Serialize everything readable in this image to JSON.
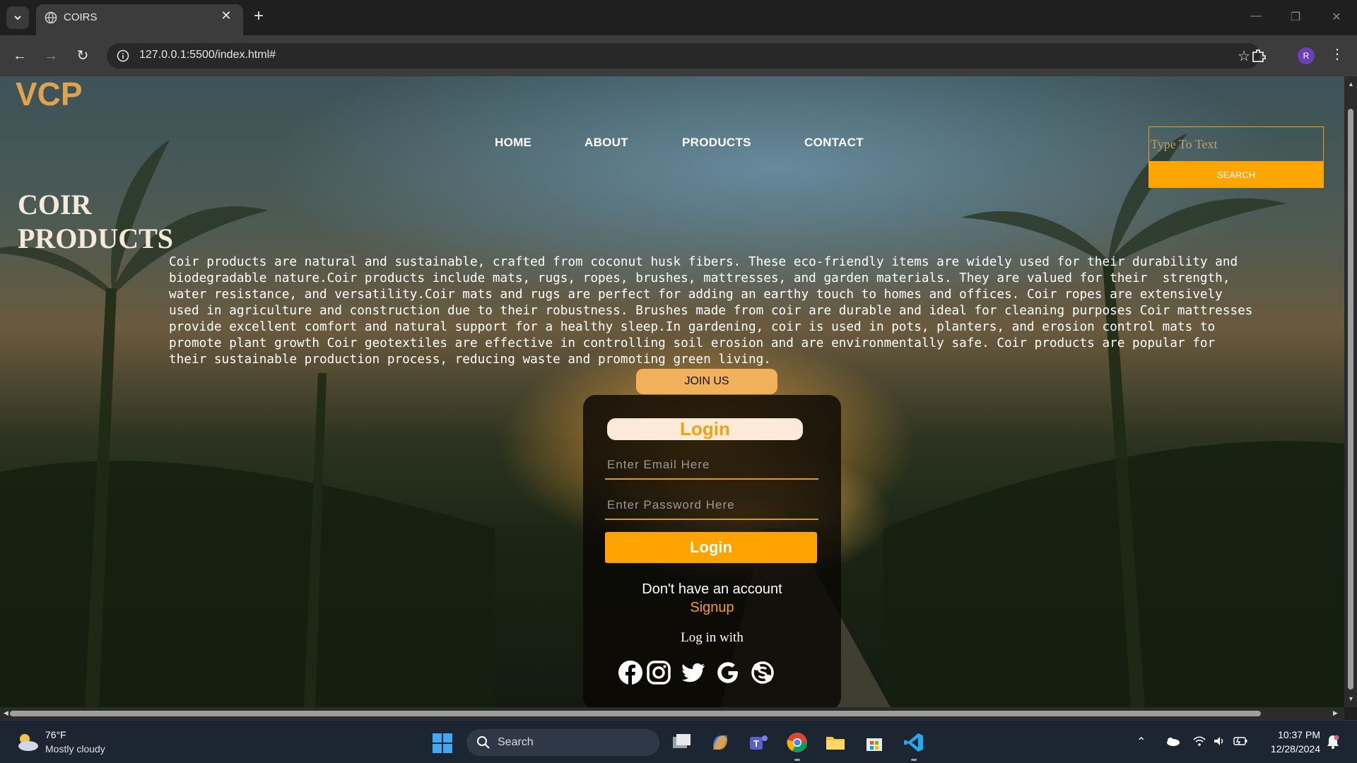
{
  "browser": {
    "tab_title": "COIRS",
    "url": "127.0.0.1:5500/index.html#",
    "profile_initial": "R"
  },
  "site": {
    "brand": "VCP",
    "nav": [
      "HOME",
      "ABOUT",
      "PRODUCTS",
      "CONTACT"
    ],
    "search": {
      "placeholder": "Type To Text",
      "button": "SEARCH"
    },
    "hero": {
      "title": "COIR PRODUCTS",
      "text": "Coir products are natural and sustainable, crafted from coconut husk fibers. These eco-friendly items are widely used for their durability and\nbiodegradable nature.Coir products include mats, rugs, ropes, brushes, mattresses, and garden materials. They are valued for their  strength,\nwater resistance, and versatility.Coir mats and rugs are perfect for adding an earthy touch to homes and offices. Coir ropes are extensively\nused in agriculture and construction due to their robustness. Brushes made from coir are durable and ideal for cleaning purposes Coir mattresses\nprovide excellent comfort and natural support for a healthy sleep.In gardening, coir is used in pots, planters, and erosion control mats to\npromote plant growth Coir geotextiles are effective in controlling soil erosion and are environmentally safe. Coir products are popular for\ntheir sustainable production process, reducing waste and promoting green living."
    },
    "join_button": "JOIN US",
    "login": {
      "heading": "Login",
      "email_placeholder": "Enter Email Here",
      "password_placeholder": "Enter Password Here",
      "submit": "Login",
      "no_account": "Don't have an account",
      "signup": "Signup",
      "login_with": "Log in with",
      "socials": [
        "facebook-icon",
        "instagram-icon",
        "twitter-icon",
        "google-icon",
        "skype-icon"
      ]
    }
  },
  "taskbar": {
    "weather_temp": "76°F",
    "weather_desc": "Mostly cloudy",
    "search_label": "Search",
    "time": "10:37 PM",
    "date": "12/28/2024"
  },
  "colors": {
    "accent": "#ffa500",
    "brand": "#e0a24a",
    "signup": "#f5a000"
  }
}
